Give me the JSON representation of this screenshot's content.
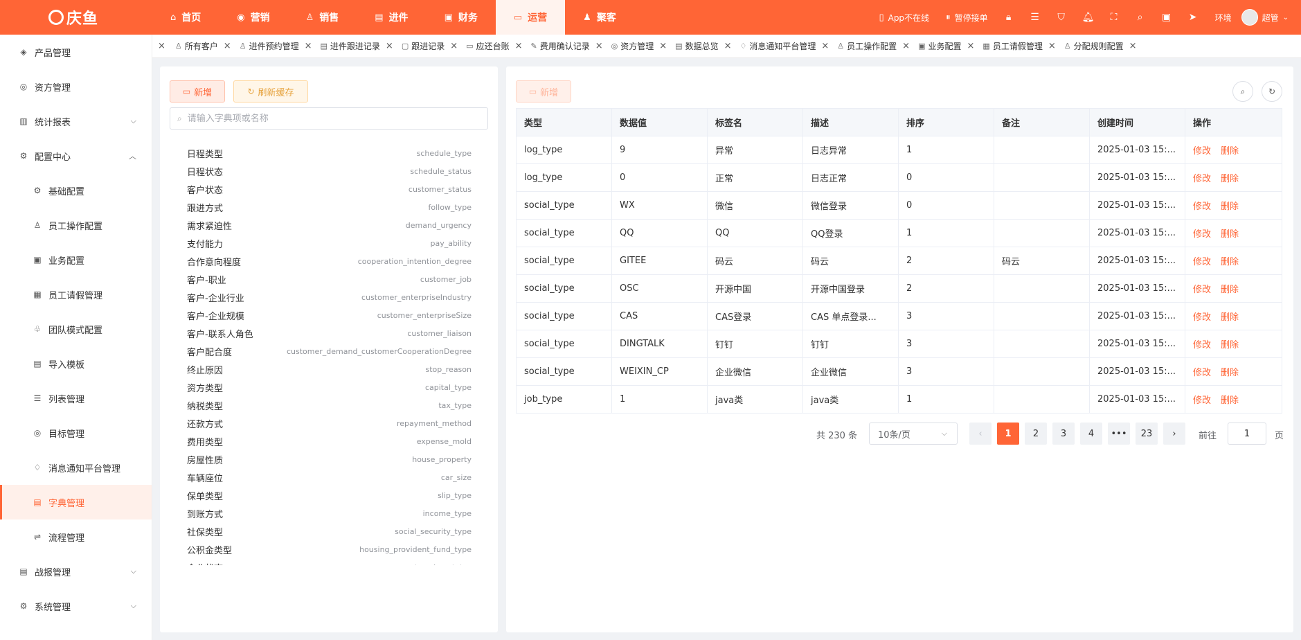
{
  "app": {
    "logo_text": "庆鱼"
  },
  "nav": [
    {
      "label": "首页",
      "icon": "home-icon",
      "glyph": "⌂"
    },
    {
      "label": "营销",
      "icon": "marketing-icon",
      "glyph": "◉"
    },
    {
      "label": "销售",
      "icon": "sales-icon",
      "glyph": "♙"
    },
    {
      "label": "进件",
      "icon": "document-icon",
      "glyph": "▤"
    },
    {
      "label": "财务",
      "icon": "finance-icon",
      "glyph": "▣"
    },
    {
      "label": "运营",
      "icon": "operations-icon",
      "glyph": "▭"
    },
    {
      "label": "聚客",
      "icon": "people-icon",
      "glyph": "♟"
    }
  ],
  "nav_active": "运营",
  "topright": {
    "app_status": "App不在线",
    "pause_orders": "暂停接单",
    "env": "环境",
    "user": "超管"
  },
  "sidebar": {
    "product": "产品管理",
    "capital": "资方管理",
    "stats": "统计报表",
    "config_center": "配置中心",
    "sub": [
      "基础配置",
      "员工操作配置",
      "业务配置",
      "员工请假管理",
      "团队模式配置",
      "导入模板",
      "列表管理",
      "目标管理",
      "消息通知平台管理",
      "字典管理",
      "流程管理"
    ],
    "battle_report": "战报管理",
    "system": "系统管理"
  },
  "tabs": [
    "所有客户",
    "进件预约管理",
    "进件跟进记录",
    "跟进记录",
    "应还台账",
    "费用确认记录",
    "资方管理",
    "数据总览",
    "消息通知平台管理",
    "员工操作配置",
    "业务配置",
    "员工请假管理",
    "分配规则配置"
  ],
  "left": {
    "add_label": "新增",
    "refresh_label": "刷新缓存",
    "search_placeholder": "请输入字典项或名称",
    "dicts": [
      {
        "name": "日程类型",
        "code": "schedule_type"
      },
      {
        "name": "日程状态",
        "code": "schedule_status"
      },
      {
        "name": "客户状态",
        "code": "customer_status"
      },
      {
        "name": "跟进方式",
        "code": "follow_type"
      },
      {
        "name": "需求紧迫性",
        "code": "demand_urgency"
      },
      {
        "name": "支付能力",
        "code": "pay_ability"
      },
      {
        "name": "合作意向程度",
        "code": "cooperation_intention_degree"
      },
      {
        "name": "客户-职业",
        "code": "customer_job"
      },
      {
        "name": "客户-企业行业",
        "code": "customer_enterpriseIndustry"
      },
      {
        "name": "客户-企业规模",
        "code": "customer_enterpriseSize"
      },
      {
        "name": "客户-联系人角色",
        "code": "customer_liaison"
      },
      {
        "name": "客户配合度",
        "code": "customer_demand_customerCooperationDegree"
      },
      {
        "name": "终止原因",
        "code": "stop_reason"
      },
      {
        "name": "资方类型",
        "code": "capital_type"
      },
      {
        "name": "纳税类型",
        "code": "tax_type"
      },
      {
        "name": "还款方式",
        "code": "repayment_method"
      },
      {
        "name": "费用类型",
        "code": "expense_mold"
      },
      {
        "name": "房屋性质",
        "code": "house_property"
      },
      {
        "name": "车辆座位",
        "code": "car_size"
      },
      {
        "name": "保单类型",
        "code": "slip_type"
      },
      {
        "name": "到账方式",
        "code": "income_type"
      },
      {
        "name": "社保类型",
        "code": "social_security_type"
      },
      {
        "name": "公积金类型",
        "code": "housing_provident_fund_type"
      },
      {
        "name": "企业状态",
        "code": "enterprise_status"
      }
    ]
  },
  "right": {
    "add_label": "新增",
    "columns": [
      "类型",
      "数据值",
      "标签名",
      "描述",
      "排序",
      "备注",
      "创建时间",
      "操作"
    ],
    "rows": [
      [
        "log_type",
        "9",
        "异常",
        "日志异常",
        "1",
        "",
        "2025-01-03 15:..."
      ],
      [
        "log_type",
        "0",
        "正常",
        "日志正常",
        "0",
        "",
        "2025-01-03 15:..."
      ],
      [
        "social_type",
        "WX",
        "微信",
        "微信登录",
        "0",
        "",
        "2025-01-03 15:..."
      ],
      [
        "social_type",
        "QQ",
        "QQ",
        "QQ登录",
        "1",
        "",
        "2025-01-03 15:..."
      ],
      [
        "social_type",
        "GITEE",
        "码云",
        "码云",
        "2",
        "码云",
        "2025-01-03 15:..."
      ],
      [
        "social_type",
        "OSC",
        "开源中国",
        "开源中国登录",
        "2",
        "",
        "2025-01-03 15:..."
      ],
      [
        "social_type",
        "CAS",
        "CAS登录",
        "CAS 单点登录...",
        "3",
        "",
        "2025-01-03 15:..."
      ],
      [
        "social_type",
        "DINGTALK",
        "钉钉",
        "钉钉",
        "3",
        "",
        "2025-01-03 15:..."
      ],
      [
        "social_type",
        "WEIXIN_CP",
        "企业微信",
        "企业微信",
        "3",
        "",
        "2025-01-03 15:..."
      ],
      [
        "job_type",
        "1",
        "java类",
        "java类",
        "1",
        "",
        "2025-01-03 15:..."
      ]
    ],
    "edit_label": "修改",
    "delete_label": "删除",
    "pagination": {
      "total": "共 230 条",
      "page_size": "10条/页",
      "pages": [
        "1",
        "2",
        "3",
        "4",
        "•••",
        "23"
      ],
      "current": "1",
      "goto_prefix": "前往",
      "goto_value": "1",
      "goto_suffix": "页"
    }
  },
  "colors": {
    "brand": "#ff6536",
    "link": "#ff6536"
  }
}
